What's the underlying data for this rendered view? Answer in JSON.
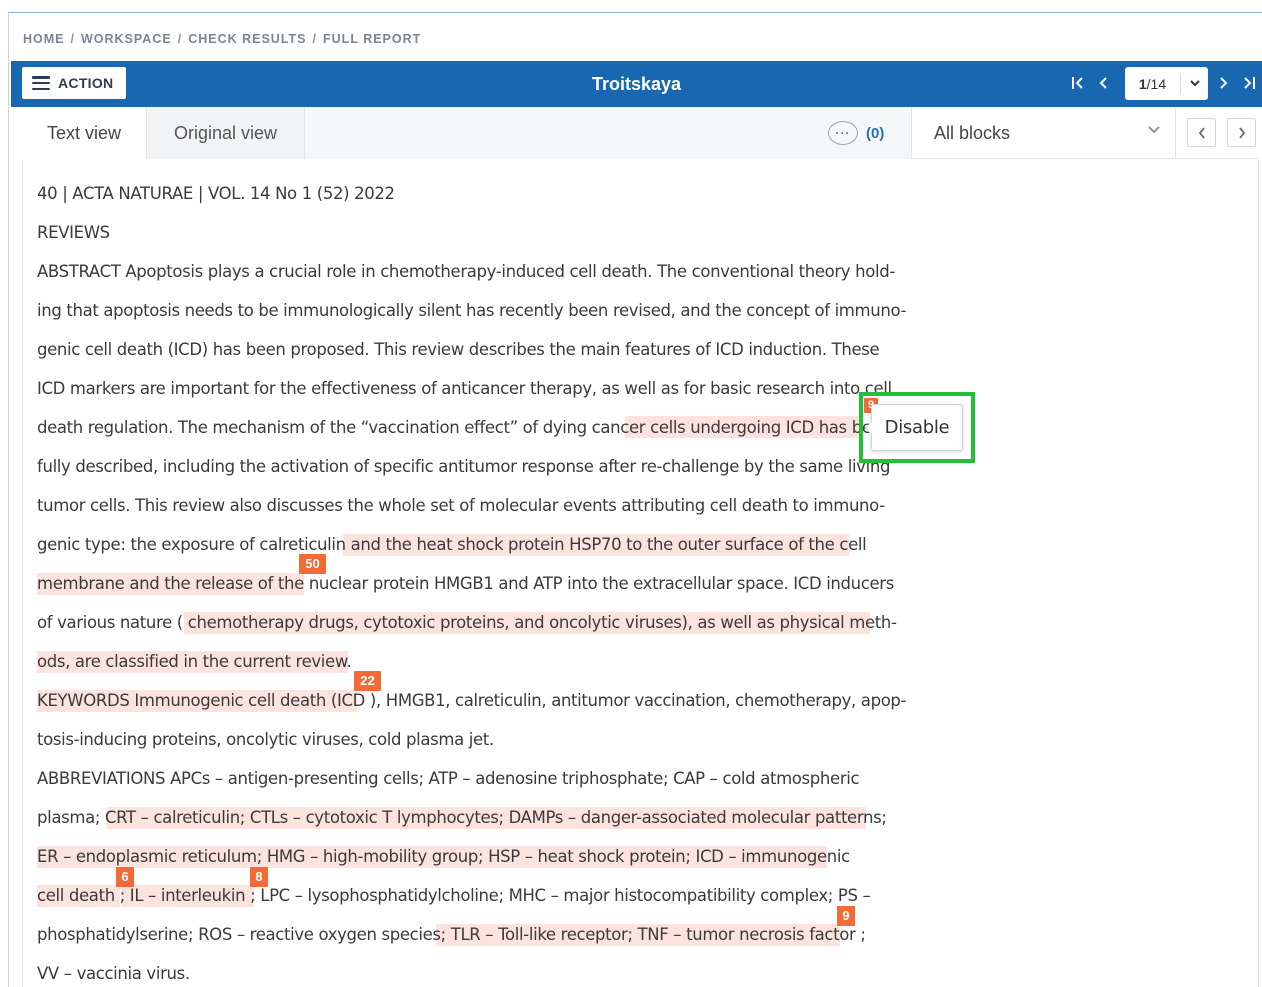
{
  "breadcrumb": {
    "home": "HOME",
    "workspace": "WORKSPACE",
    "check_results": "CHECK RESULTS",
    "full_report": "FULL REPORT",
    "sep": "/"
  },
  "toolbar": {
    "action_label": "ACTION",
    "title": "Troitskaya",
    "page_current": "1",
    "page_total": "/14",
    "first_icon": "first-page-icon",
    "prev_icon": "prev-page-icon",
    "next_icon": "next-page-icon",
    "last_icon": "last-page-icon"
  },
  "tabs": {
    "text_view": "Text view",
    "original_view": "Original view"
  },
  "comments": {
    "count": "(0)",
    "icon": "comment-bubble-icon",
    "glyph": "···"
  },
  "blocks_select": {
    "value": "All blocks"
  },
  "popup": {
    "label": "Disable"
  },
  "highlight_color": "#fde3dd",
  "badge_color": "#f26a36",
  "accent_color": "#1a67b1",
  "text_lines": [
    "40 | ACTA NATURAE | VOL. 14 No 1 (52) 2022",
    "REVIEWS",
    "ABSTRACT Apoptosis plays a crucial role in chemotherapy-induced cell death. The conventional theory hold-",
    "ing that apoptosis needs to be immunologically silent has recently been revised, and the concept of immuno-",
    "genic cell death (ICD) has been proposed. This review describes the main features of ICD induction. These",
    "ICD markers are important for the effectiveness of anticancer therapy, as well as for basic research into cell",
    "death regulation. The mechanism of the “vaccination effect” of dying cancer   cells undergoing ICD has been",
    "fully described, including the activation of specific antitumor response after re-challenge by the same living",
    "tumor cells. This review also discusses the whole set of molecular events attributing cell death to immuno-",
    "genic type: the exposure of calreticulin   and the heat shock protein HSP70 to the outer surface of the cell",
    "membrane and the release of the     nuclear protein HMGB1 and ATP into the extracellular space. ICD inducers",
    "of various nature (  chemotherapy drugs, cytotoxic proteins, and oncolytic viruses), as well as physical meth-",
    "ods, are classified in the current review.",
    "KEYWORDS Immunogenic cell death (ICD     ), HMGB1, calreticulin, antitumor vaccination, chemotherapy, apop-",
    "tosis-inducing proteins, oncolytic viruses, cold plasma jet.",
    "ABBREVIATIONS APCs – antigen-presenting cells; ATP – adenosine triphosphate; CAP – cold atmospheric",
    "plasma;   CRT – calreticulin; CTLs – cytotoxic T lymphocytes; DAMPs – danger-associated molecular patterns;",
    "ER – endoplasmic reticulum; HMG – high-mobility group; HSP – heat shock protein; ICD – immunogenic",
    "cell death   ; IL – interleukin    ; LPC – lysophosphatidylcholine; MHC – major histocompatibility complex; PS –",
    "phosphatidylserine; ROS – reactive oxygen species;   TLR – Toll-like receptor; TNF – tumor necrosis factor   ;",
    "VV – vaccinia virus."
  ],
  "badges": [
    "9",
    "50",
    "22",
    "6",
    "8",
    "9"
  ]
}
